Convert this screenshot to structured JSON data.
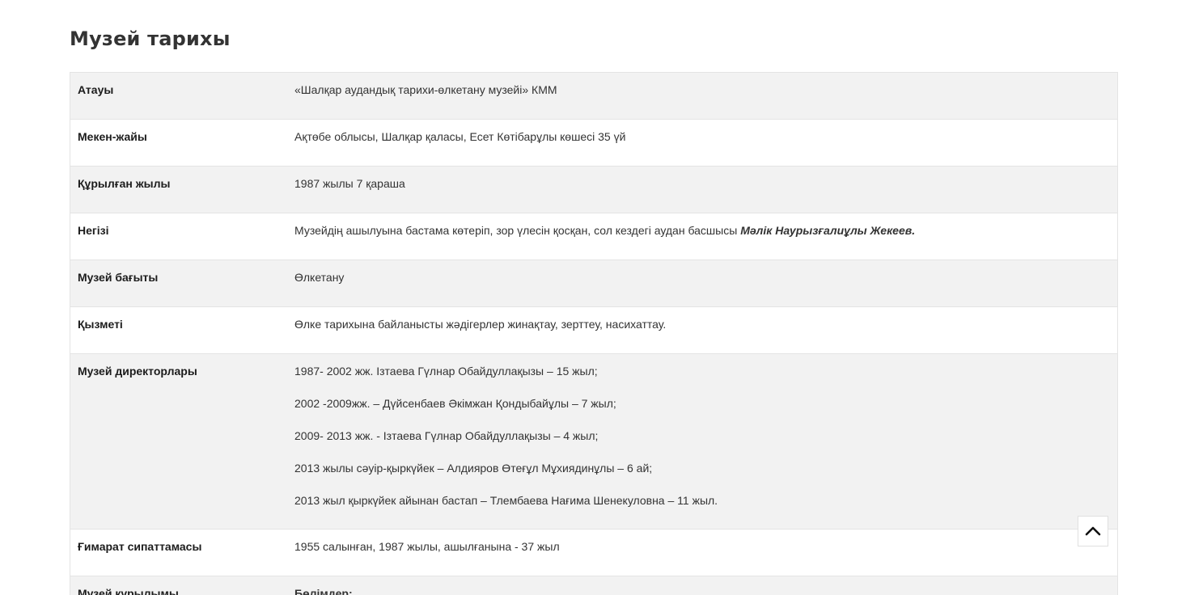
{
  "page": {
    "title": "Музей тарихы"
  },
  "table": {
    "rows": [
      {
        "key": "Атауы",
        "value": "«Шалқар аудандық тарихи-өлкетану музейі» КММ"
      },
      {
        "key": "Мекен-жайы",
        "value": "Ақтөбе облысы, Шалқар қаласы, Есет Көтібарұлы көшесі 35 үй"
      },
      {
        "key": "Құрылған жылы",
        "value": "1987 жылы 7 қараша"
      },
      {
        "key": "Негізі",
        "value": "Музейдің ашылуына бастама көтеріп, зор үлесін қосқан, сол кездегі аудан басшысы ",
        "emphasis": "Мәлік Наурызғалиұлы Жекеев."
      },
      {
        "key": "Музей бағыты",
        "value": "Өлкетану"
      },
      {
        "key": "Қызметі",
        "value": "Өлке тарихына байланысты жәдігерлер жинақтау, зерттеу, насихаттау."
      },
      {
        "key": "Музей директорлары",
        "lines": [
          "1987- 2002 жж. Ізтаева Гүлнар Обайдуллақызы – 15 жыл;",
          "2002 -2009жж. – Дүйсенбаев Әкімжан Қондыбайұлы – 7 жыл;",
          "2009- 2013 жж. - Ізтаева Гүлнар Обайдуллақызы – 4 жыл;",
          "2013 жылы сәуір-қыркүйек – Алдияров Өтеғұл Мұхиядинұлы – 6 ай;",
          "2013 жыл қыркүйек айынан бастап – Тлембаева Нағима Шенекуловна – 11 жыл."
        ]
      },
      {
        "key": "Ғимарат сипаттамасы",
        "value": "1955 салынған, 1987 жылы, ашылғанына - 37 жыл"
      },
      {
        "key": "Музей құрылымы",
        "value_bold": "Бөлімдер:"
      }
    ]
  },
  "scroll_top": {
    "icon": "chevron-up-icon"
  },
  "colors": {
    "row_shade": "#f2f2f2",
    "border": "#e4e4e4",
    "text": "#333333"
  }
}
